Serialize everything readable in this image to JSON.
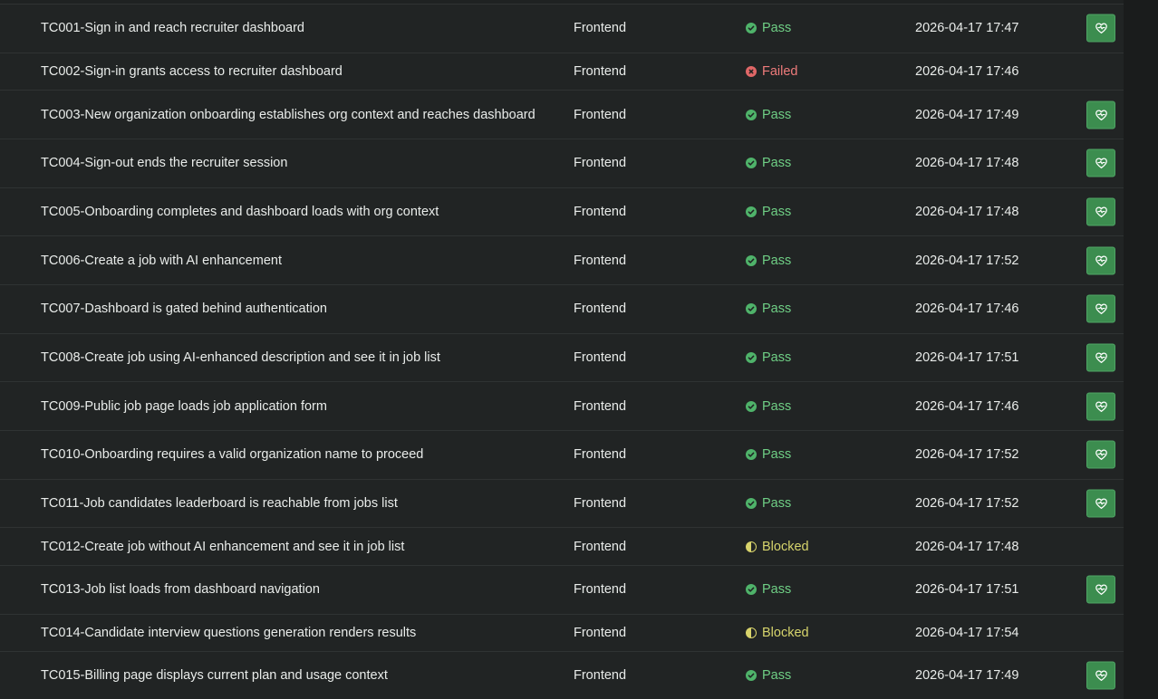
{
  "table": {
    "rows": [
      {
        "name": "TC001-Sign in and reach recruiter dashboard",
        "type": "Frontend",
        "status": "Pass",
        "date": "2026-04-17 17:47",
        "has_action": true
      },
      {
        "name": "TC002-Sign-in grants access to recruiter dashboard",
        "type": "Frontend",
        "status": "Failed",
        "date": "2026-04-17 17:46",
        "has_action": false
      },
      {
        "name": "TC003-New organization onboarding establishes org context and reaches dashboard",
        "type": "Frontend",
        "status": "Pass",
        "date": "2026-04-17 17:49",
        "has_action": true
      },
      {
        "name": "TC004-Sign-out ends the recruiter session",
        "type": "Frontend",
        "status": "Pass",
        "date": "2026-04-17 17:48",
        "has_action": true
      },
      {
        "name": "TC005-Onboarding completes and dashboard loads with org context",
        "type": "Frontend",
        "status": "Pass",
        "date": "2026-04-17 17:48",
        "has_action": true
      },
      {
        "name": "TC006-Create a job with AI enhancement",
        "type": "Frontend",
        "status": "Pass",
        "date": "2026-04-17 17:52",
        "has_action": true
      },
      {
        "name": "TC007-Dashboard is gated behind authentication",
        "type": "Frontend",
        "status": "Pass",
        "date": "2026-04-17 17:46",
        "has_action": true
      },
      {
        "name": "TC008-Create job using AI-enhanced description and see it in job list",
        "type": "Frontend",
        "status": "Pass",
        "date": "2026-04-17 17:51",
        "has_action": true
      },
      {
        "name": "TC009-Public job page loads job application form",
        "type": "Frontend",
        "status": "Pass",
        "date": "2026-04-17 17:46",
        "has_action": true
      },
      {
        "name": "TC010-Onboarding requires a valid organization name to proceed",
        "type": "Frontend",
        "status": "Pass",
        "date": "2026-04-17 17:52",
        "has_action": true
      },
      {
        "name": "TC011-Job candidates leaderboard is reachable from jobs list",
        "type": "Frontend",
        "status": "Pass",
        "date": "2026-04-17 17:52",
        "has_action": true
      },
      {
        "name": "TC012-Create job without AI enhancement and see it in job list",
        "type": "Frontend",
        "status": "Blocked",
        "date": "2026-04-17 17:48",
        "has_action": false
      },
      {
        "name": "TC013-Job list loads from dashboard navigation",
        "type": "Frontend",
        "status": "Pass",
        "date": "2026-04-17 17:51",
        "has_action": true
      },
      {
        "name": "TC014-Candidate interview questions generation renders results",
        "type": "Frontend",
        "status": "Blocked",
        "date": "2026-04-17 17:54",
        "has_action": false
      },
      {
        "name": "TC015-Billing page displays current plan and usage context",
        "type": "Frontend",
        "status": "Pass",
        "date": "2026-04-17 17:49",
        "has_action": true
      }
    ]
  },
  "icons": {
    "pass": "check-circle-icon",
    "failed": "x-circle-icon",
    "blocked": "half-circle-icon",
    "action": "heart-pulse-icon"
  },
  "colors": {
    "pass": "#6fcf85",
    "failed": "#ee7b7b",
    "blocked": "#d6d46c",
    "action_bg": "#3c8d4f"
  }
}
